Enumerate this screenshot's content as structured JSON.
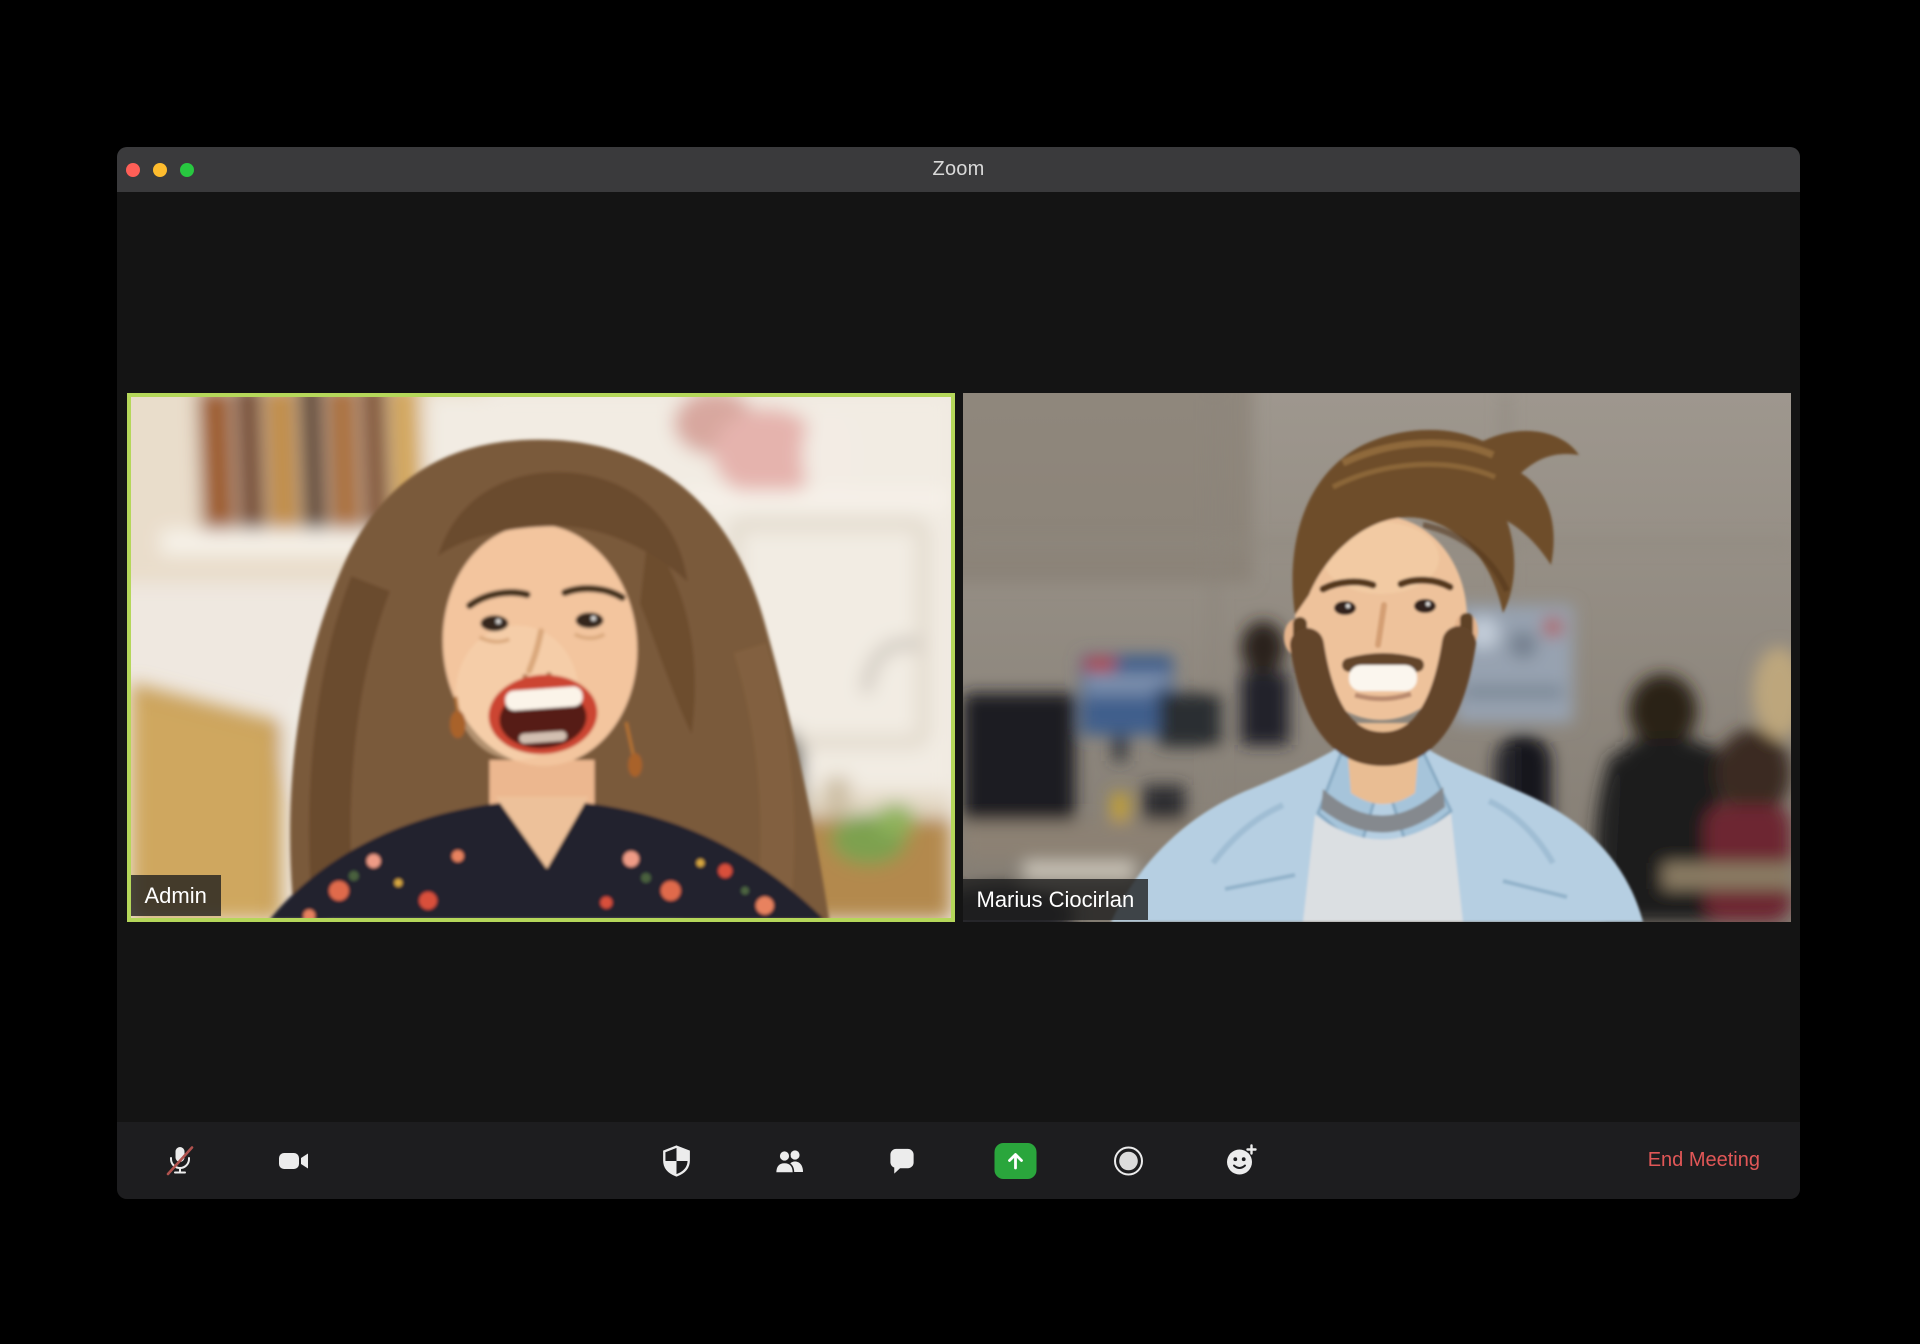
{
  "window": {
    "title": "Zoom",
    "traffic_lights": [
      {
        "name": "close",
        "color": "#ff5f57"
      },
      {
        "name": "minimize",
        "color": "#febc2e"
      },
      {
        "name": "zoom",
        "color": "#28c840"
      }
    ]
  },
  "participants": [
    {
      "name": "Admin",
      "role": "active-speaker",
      "highlighted": true
    },
    {
      "name": "Marius Ciocirlan",
      "role": "participant",
      "highlighted": false
    }
  ],
  "toolbar": {
    "buttons": [
      {
        "id": "mute",
        "icon": "microphone-muted-icon",
        "state": "muted"
      },
      {
        "id": "video",
        "icon": "video-camera-icon",
        "state": "on"
      },
      {
        "id": "security",
        "icon": "security-shield-icon"
      },
      {
        "id": "participants",
        "icon": "participants-icon"
      },
      {
        "id": "chat",
        "icon": "chat-bubble-icon"
      },
      {
        "id": "share-screen",
        "icon": "share-screen-icon"
      },
      {
        "id": "record",
        "icon": "record-icon"
      },
      {
        "id": "reactions",
        "icon": "reactions-icon"
      }
    ],
    "end_meeting_label": "End Meeting"
  },
  "colors": {
    "active_speaker_border": "#b5d75a",
    "share_button_green": "#2aa63c",
    "end_meeting_red": "#e15757",
    "titlebar_bg": "#3a3a3c",
    "toolbar_bg": "#1d1d1f",
    "window_bg": "#141414",
    "mic_muted_slash": "#b0524e"
  }
}
